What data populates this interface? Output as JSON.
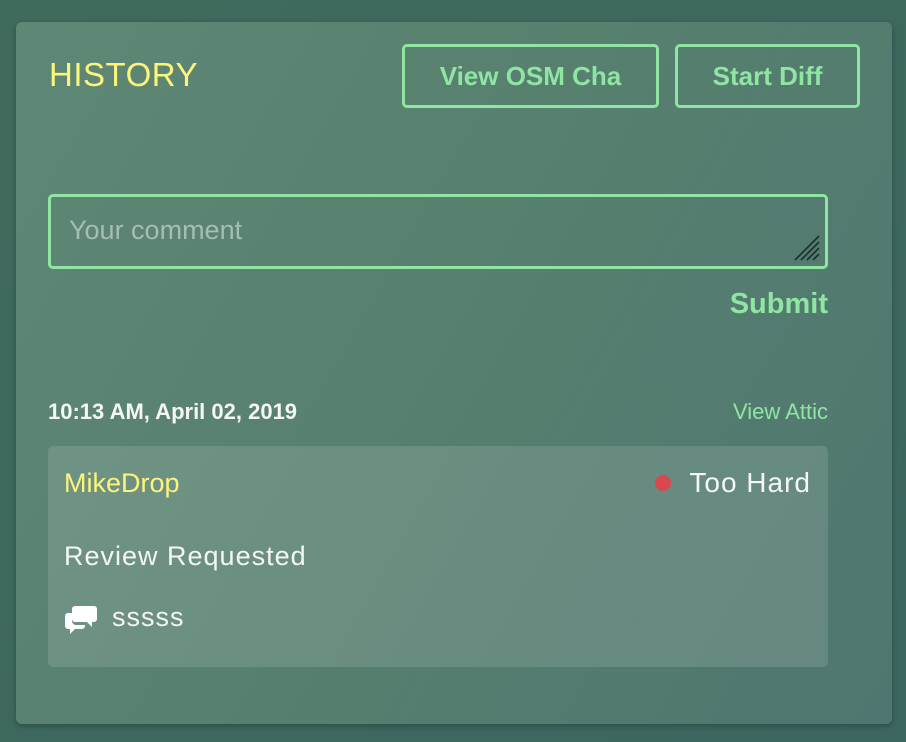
{
  "history": {
    "title": "HISTORY",
    "buttons": {
      "view_osm": "View OSM Cha",
      "start_diff": "Start Diff"
    },
    "comment_field": {
      "value": "",
      "placeholder": "Your comment"
    },
    "submit_label": "Submit",
    "entries": [
      {
        "timestamp": "10:13 AM, April 02, 2019",
        "view_attic_label": "View Attic",
        "user": "MikeDrop",
        "status": "Too Hard",
        "status_color": "#d8484d",
        "action": "Review Requested",
        "comment": "sssss",
        "comment_icon": "comments-icon"
      }
    ]
  },
  "colors": {
    "accent": "#8fe5a2",
    "title": "#fcf57a",
    "status_too_hard": "#d8484d"
  }
}
